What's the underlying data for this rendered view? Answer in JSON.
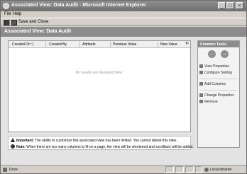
{
  "window": {
    "title": "Associated View: Data Audit - Microsoft Internet Explorer"
  },
  "menu": {
    "file": "File",
    "help": "Help"
  },
  "toolbar": {
    "save_close_label": "Save and Close"
  },
  "view": {
    "header": "Associated View: Data Audit"
  },
  "grid": {
    "columns": [
      "Created On",
      "Created By",
      "Attribute",
      "Previous Value",
      "New Value"
    ],
    "sort_indicator": "▽",
    "refresh_glyph": "↻",
    "empty_message": "No results are displayed here."
  },
  "notes": {
    "important_label": "Important:",
    "important_text": "The ability to customize this associated view has been limited. You cannot delete this view.",
    "note_label": "Note:",
    "note_text": "When there are too many columns to fit on a page, the view will be shortened and scrollbars will be added."
  },
  "tasks": {
    "title": "Common Tasks",
    "back_glyph": "←",
    "forward_glyph": "→",
    "items": [
      "View Properties",
      "Configure Sorting",
      "Add Columns",
      "Change Properties",
      "Remove"
    ]
  },
  "statusbar": {
    "status": "Done",
    "zone": "Local intranet"
  },
  "icons": [
    "ie-icon",
    "print-icon",
    "save-icon",
    "refresh-icon",
    "warning-icon",
    "info-icon",
    "back-arrow-icon",
    "forward-arrow-icon",
    "done-page-icon",
    "globe-icon"
  ]
}
